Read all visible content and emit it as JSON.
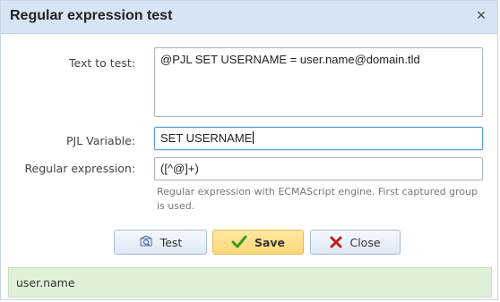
{
  "dialog": {
    "title": "Regular expression test",
    "close_glyph": "×"
  },
  "form": {
    "text_to_test_label": "Text to test:",
    "text_to_test_value": "@PJL SET USERNAME = user.name@domain.tld",
    "pjl_variable_label": "PJL Variable:",
    "pjl_variable_value": "SET USERNAME",
    "regex_label": "Regular expression:",
    "regex_value": "([^@]+)",
    "regex_help": "Regular expression with ECMAScript engine. First captured group is used."
  },
  "buttons": {
    "test_label": "Test",
    "save_label": "Save",
    "close_label": "Close"
  },
  "icons": {
    "test": "test-icon",
    "save": "checkmark-icon",
    "close": "red-x-icon"
  },
  "colors": {
    "titlebar": "#d6e4f3",
    "save_button": "#ffd77a",
    "result_background": "#dff0d8",
    "checkmark": "#3c9a1e",
    "close_x": "#c0201a"
  },
  "result": {
    "text": "user.name"
  }
}
